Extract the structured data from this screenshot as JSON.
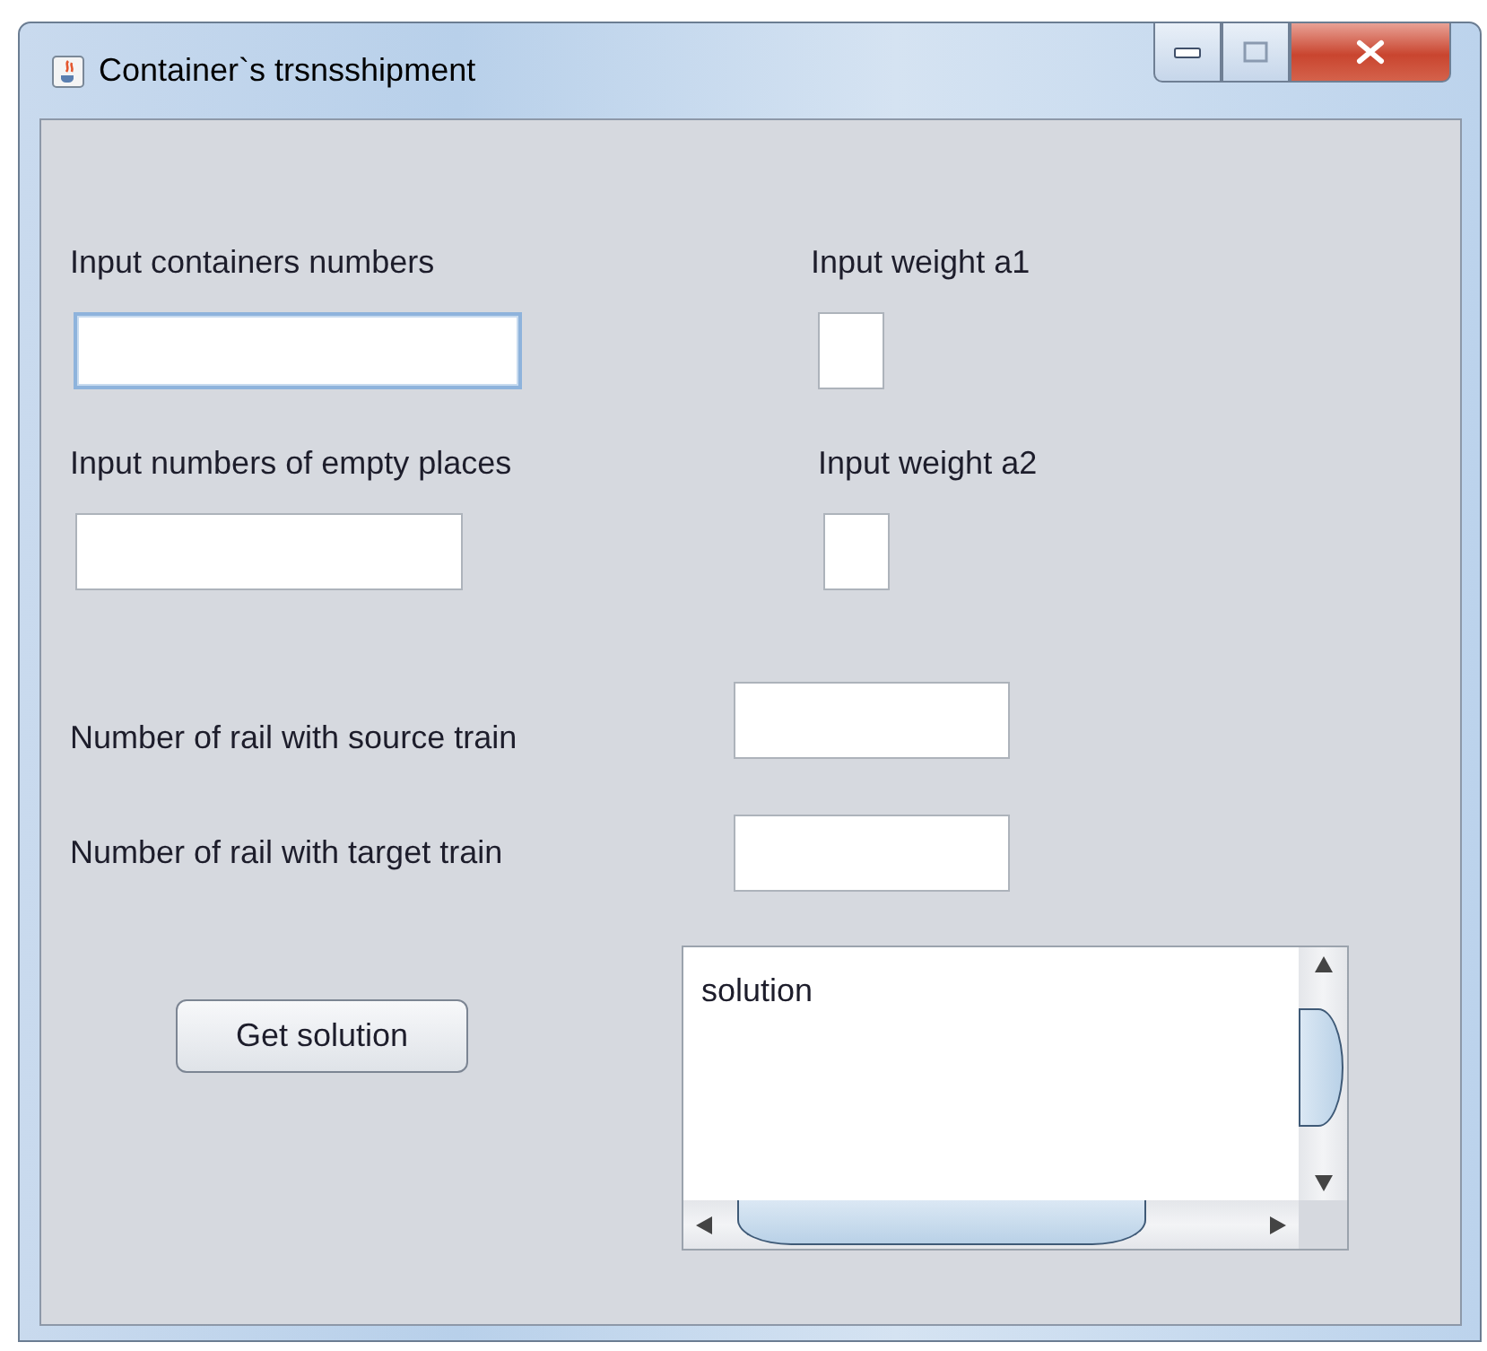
{
  "window": {
    "title": "Container`s trsnsshipment"
  },
  "rows": [
    {
      "label": "Input containers numbers",
      "field": {
        "focused": true
      },
      "side_label": "Input weight a1",
      "side_field": {
        "focused": false
      }
    },
    {
      "label": "Input numbers of empty places",
      "field": {
        "focused": false
      },
      "side_label": "Input weight a2",
      "side_field": {
        "focused": false
      }
    }
  ],
  "rails": [
    {
      "label": "Number of rail with source train",
      "field": {
        "focused": false
      }
    },
    {
      "label": "Number of rail with target train",
      "field": {
        "focused": false
      }
    }
  ],
  "button": {
    "label": "Get solution"
  },
  "output": {
    "value": "solution"
  }
}
